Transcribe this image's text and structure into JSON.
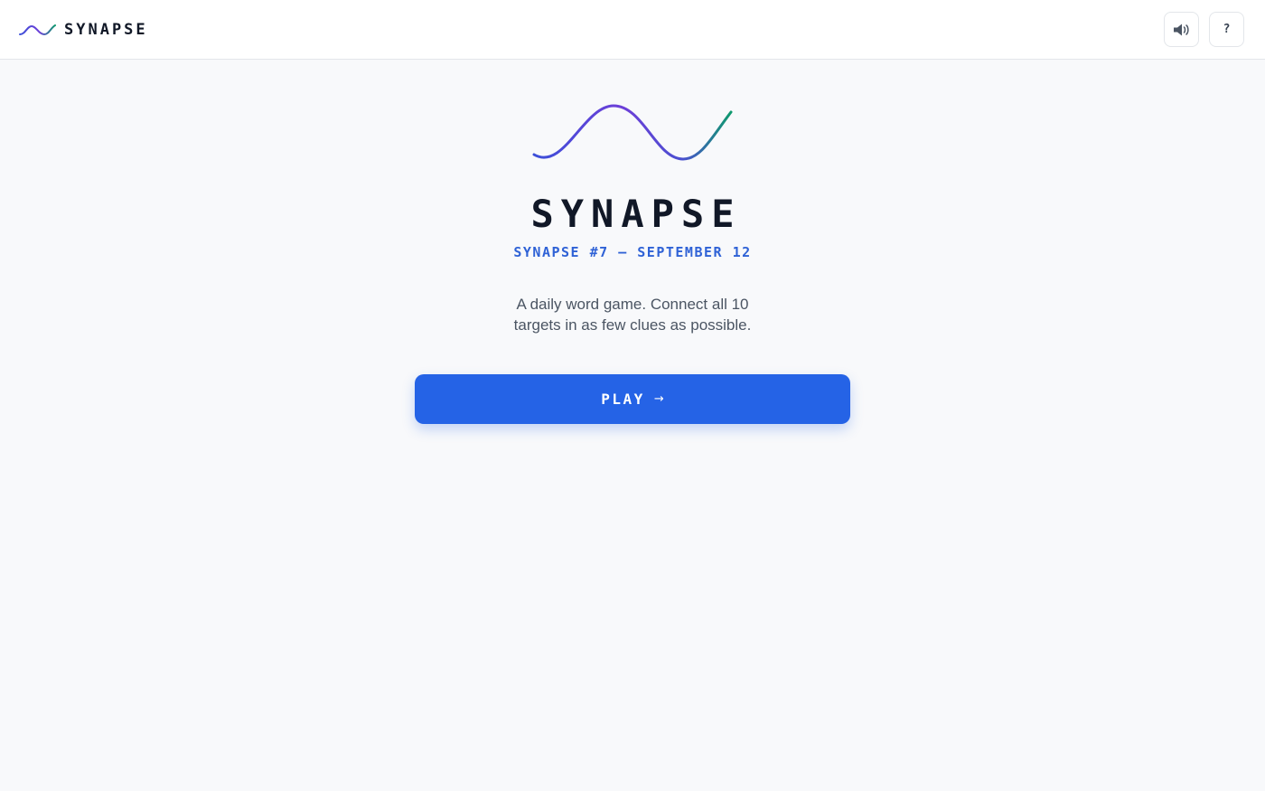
{
  "header": {
    "brand_name": "SYNAPSE",
    "sound_icon": "speaker-volume-icon",
    "help_label": "?",
    "help_icon": "question-mark-icon"
  },
  "hero": {
    "logo_icon": "wave-logo-icon",
    "title": "SYNAPSE",
    "subtitle": "SYNAPSE #7 — SEPTEMBER 12",
    "description": "A daily word game. Connect all 10 targets in as few clues as possible.",
    "play_label": "PLAY",
    "play_arrow": "→"
  },
  "colors": {
    "accent": "#2563e6",
    "subtitle": "#2f62d6",
    "wave_start": "#3b4fd8",
    "wave_mid": "#6d3fd8",
    "wave_end": "#0f9a6e",
    "background": "#f8f9fb"
  }
}
